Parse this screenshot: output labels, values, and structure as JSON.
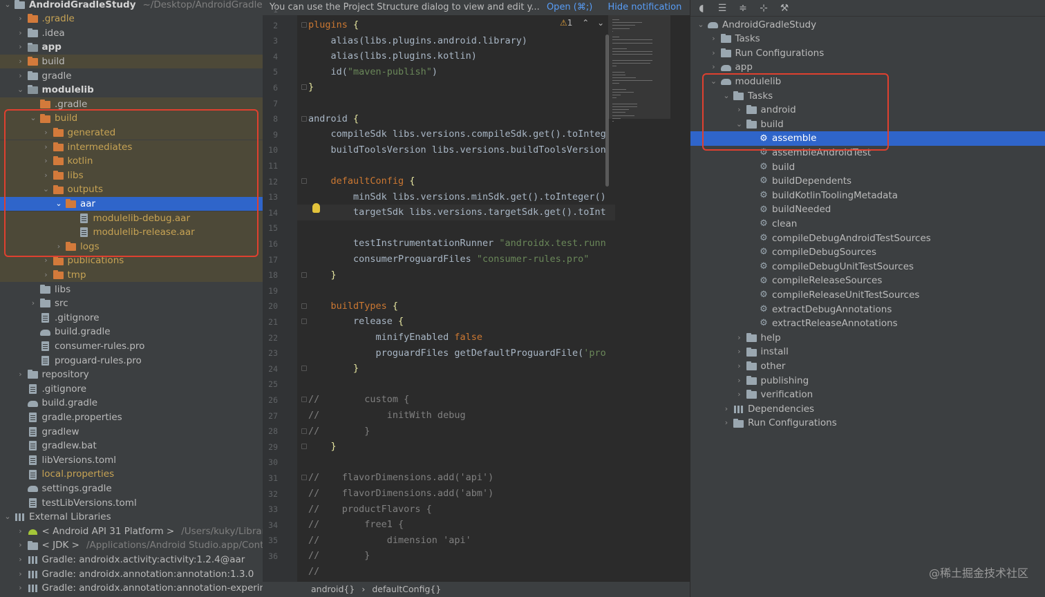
{
  "project_tree": [
    {
      "label": "AndroidGradleStudy",
      "path": "~/Desktop/AndroidGradleStu",
      "chev": "v",
      "icon": "folder",
      "bold": true
    },
    {
      "label": ".gradle",
      "chev": ">",
      "icon": "folder-excluded",
      "orange": true
    },
    {
      "label": ".idea",
      "chev": ">",
      "icon": "folder"
    },
    {
      "label": "app",
      "chev": ">",
      "icon": "folder-module",
      "bold": true
    },
    {
      "label": "build",
      "chev": ">",
      "icon": "folder-excluded",
      "excluded": true
    },
    {
      "label": "gradle",
      "chev": ">",
      "icon": "folder"
    },
    {
      "label": "modulelib",
      "chev": "v",
      "icon": "folder-module",
      "bold": true
    },
    {
      "label": ".gradle",
      "icon": "folder-excluded",
      "excluded": true
    },
    {
      "label": "build",
      "chev": "v",
      "icon": "folder-excluded",
      "orange": true,
      "excluded": true
    },
    {
      "label": "generated",
      "chev": ">",
      "icon": "folder-excluded",
      "orange": true,
      "excluded": true
    },
    {
      "label": "intermediates",
      "chev": ">",
      "icon": "folder-excluded",
      "orange": true,
      "excluded": true
    },
    {
      "label": "kotlin",
      "chev": ">",
      "icon": "folder-excluded",
      "orange": true,
      "excluded": true
    },
    {
      "label": "libs",
      "chev": ">",
      "icon": "folder-excluded",
      "orange": true,
      "excluded": true
    },
    {
      "label": "outputs",
      "chev": "v",
      "icon": "folder-excluded",
      "orange": true,
      "excluded": true
    },
    {
      "label": "aar",
      "chev": "v",
      "icon": "folder-excluded",
      "selected": true
    },
    {
      "label": "modulelib-debug.aar",
      "icon": "file",
      "orange": true,
      "excluded": true
    },
    {
      "label": "modulelib-release.aar",
      "icon": "file",
      "orange": true,
      "excluded": true
    },
    {
      "label": "logs",
      "chev": ">",
      "icon": "folder-excluded",
      "orange": true,
      "excluded": true
    },
    {
      "label": "publications",
      "chev": ">",
      "icon": "folder-excluded",
      "orange": true,
      "excluded": true
    },
    {
      "label": "tmp",
      "chev": ">",
      "icon": "folder-excluded",
      "orange": true,
      "excluded": true
    },
    {
      "label": "libs",
      "icon": "folder"
    },
    {
      "label": "src",
      "chev": ">",
      "icon": "folder"
    },
    {
      "label": ".gitignore",
      "icon": "file"
    },
    {
      "label": "build.gradle",
      "icon": "gradle"
    },
    {
      "label": "consumer-rules.pro",
      "icon": "file"
    },
    {
      "label": "proguard-rules.pro",
      "icon": "file"
    },
    {
      "label": "repository",
      "chev": ">",
      "icon": "folder"
    },
    {
      "label": ".gitignore",
      "icon": "file"
    },
    {
      "label": "build.gradle",
      "icon": "gradle"
    },
    {
      "label": "gradle.properties",
      "icon": "file"
    },
    {
      "label": "gradlew",
      "icon": "file"
    },
    {
      "label": "gradlew.bat",
      "icon": "file"
    },
    {
      "label": "libVersions.toml",
      "icon": "file"
    },
    {
      "label": "local.properties",
      "icon": "file",
      "orange": true
    },
    {
      "label": "settings.gradle",
      "icon": "gradle"
    },
    {
      "label": "testLibVersions.toml",
      "icon": "file"
    },
    {
      "label": "External Libraries",
      "chev": "v",
      "icon": "library"
    },
    {
      "label": "< Android API 31 Platform >",
      "path": "/Users/kuky/Librar",
      "chev": ">",
      "icon": "android"
    },
    {
      "label": "< JDK >",
      "path": "/Applications/Android Studio.app/Conte",
      "chev": ">",
      "icon": "folder"
    },
    {
      "label": "Gradle: androidx.activity:activity:1.2.4@aar",
      "chev": ">",
      "icon": "library"
    },
    {
      "label": "Gradle: androidx.annotation:annotation:1.3.0",
      "chev": ">",
      "icon": "library"
    },
    {
      "label": "Gradle: androidx.annotation:annotation-experim",
      "chev": ">",
      "icon": "library"
    }
  ],
  "notification": {
    "text": "You can use the Project Structure dialog to view and edit y...",
    "open": "Open (⌘;)",
    "hide": "Hide notification"
  },
  "warning": {
    "count": "1"
  },
  "code_lines": [
    [
      [
        "k",
        "plugins "
      ],
      [
        "br",
        "{"
      ]
    ],
    [
      [
        "",
        "    alias(libs.plugins.android.library)"
      ]
    ],
    [
      [
        "",
        "    alias(libs.plugins.kotlin)"
      ]
    ],
    [
      [
        "",
        "    id("
      ],
      [
        "s",
        "\"maven-publish\""
      ],
      [
        "",
        ")"
      ]
    ],
    [
      [
        "br",
        "}"
      ]
    ],
    [],
    [
      [
        "",
        "android "
      ],
      [
        "br",
        "{"
      ]
    ],
    [
      [
        "",
        "    compileSdk libs.versions.compileSdk.get().toInteg"
      ]
    ],
    [
      [
        "",
        "    buildToolsVersion libs.versions.buildToolsVersion"
      ]
    ],
    [],
    [
      [
        "k",
        "    defaultConfig "
      ],
      [
        "br",
        "{"
      ]
    ],
    [
      [
        "",
        "        minSdk libs.versions.minSdk.get().toInteger()"
      ]
    ],
    [
      [
        "",
        "        targetSdk libs.versions.targetSdk.get().toInt"
      ]
    ],
    [],
    [
      [
        "",
        "        testInstrumentationRunner "
      ],
      [
        "s",
        "\"androidx.test.runn"
      ]
    ],
    [
      [
        "",
        "        consumerProguardFiles "
      ],
      [
        "s",
        "\"consumer-rules.pro\""
      ]
    ],
    [
      [
        "",
        "    "
      ],
      [
        "br",
        "}"
      ]
    ],
    [],
    [
      [
        "k",
        "    buildTypes "
      ],
      [
        "br",
        "{"
      ]
    ],
    [
      [
        "",
        "        release "
      ],
      [
        "br",
        "{"
      ]
    ],
    [
      [
        "",
        "            minifyEnabled "
      ],
      [
        "k",
        "false"
      ]
    ],
    [
      [
        "",
        "            proguardFiles getDefaultProguardFile("
      ],
      [
        "s",
        "'pro"
      ]
    ],
    [
      [
        "",
        "        "
      ],
      [
        "br",
        "}"
      ]
    ],
    [],
    [
      [
        "c",
        "//        custom {"
      ]
    ],
    [
      [
        "c",
        "//            initWith debug"
      ]
    ],
    [
      [
        "c",
        "//        }"
      ]
    ],
    [
      [
        "",
        "    "
      ],
      [
        "br",
        "}"
      ]
    ],
    [],
    [
      [
        "c",
        "//    flavorDimensions.add('api')"
      ]
    ],
    [
      [
        "c",
        "//    flavorDimensions.add('abm')"
      ]
    ],
    [
      [
        "c",
        "//    productFlavors {"
      ]
    ],
    [
      [
        "c",
        "//        free1 {"
      ]
    ],
    [
      [
        "c",
        "//            dimension 'api'"
      ]
    ],
    [
      [
        "c",
        "//        }"
      ]
    ],
    [
      [
        "c",
        "//"
      ]
    ]
  ],
  "breadcrumb": [
    "android{}",
    "›",
    "defaultConfig{}"
  ],
  "gradle_tree": [
    {
      "label": "AndroidGradleStudy",
      "chev": "v",
      "icon": "gradle"
    },
    {
      "label": "Tasks",
      "chev": ">",
      "icon": "folder-tasks"
    },
    {
      "label": "Run Configurations",
      "chev": ">",
      "icon": "folder-tasks"
    },
    {
      "label": "app",
      "chev": ">",
      "icon": "gradle"
    },
    {
      "label": "modulelib",
      "chev": "v",
      "icon": "gradle"
    },
    {
      "label": "Tasks",
      "chev": "v",
      "icon": "folder-tasks"
    },
    {
      "label": "android",
      "chev": ">",
      "icon": "folder-tasks"
    },
    {
      "label": "build",
      "chev": "v",
      "icon": "folder-tasks"
    },
    {
      "label": "assemble",
      "icon": "gear",
      "selected": true
    },
    {
      "label": "assembleAndroidTest",
      "icon": "gear"
    },
    {
      "label": "build",
      "icon": "gear"
    },
    {
      "label": "buildDependents",
      "icon": "gear"
    },
    {
      "label": "buildKotlinToolingMetadata",
      "icon": "gear"
    },
    {
      "label": "buildNeeded",
      "icon": "gear"
    },
    {
      "label": "clean",
      "icon": "gear"
    },
    {
      "label": "compileDebugAndroidTestSources",
      "icon": "gear"
    },
    {
      "label": "compileDebugSources",
      "icon": "gear"
    },
    {
      "label": "compileDebugUnitTestSources",
      "icon": "gear"
    },
    {
      "label": "compileReleaseSources",
      "icon": "gear"
    },
    {
      "label": "compileReleaseUnitTestSources",
      "icon": "gear"
    },
    {
      "label": "extractDebugAnnotations",
      "icon": "gear"
    },
    {
      "label": "extractReleaseAnnotations",
      "icon": "gear"
    },
    {
      "label": "help",
      "chev": ">",
      "icon": "folder-tasks"
    },
    {
      "label": "install",
      "chev": ">",
      "icon": "folder-tasks"
    },
    {
      "label": "other",
      "chev": ">",
      "icon": "folder-tasks"
    },
    {
      "label": "publishing",
      "chev": ">",
      "icon": "folder-tasks"
    },
    {
      "label": "verification",
      "chev": ">",
      "icon": "folder-tasks"
    },
    {
      "label": "Dependencies",
      "chev": ">",
      "icon": "library"
    },
    {
      "label": "Run Configurations",
      "chev": ">",
      "icon": "folder-tasks"
    }
  ],
  "gradle_toolbar": [
    "elephant-icon",
    "expand-all-icon",
    "collapse-all-icon",
    "toggle-offline-icon",
    "wrench-icon"
  ],
  "watermark": "@稀土掘金技术社区"
}
